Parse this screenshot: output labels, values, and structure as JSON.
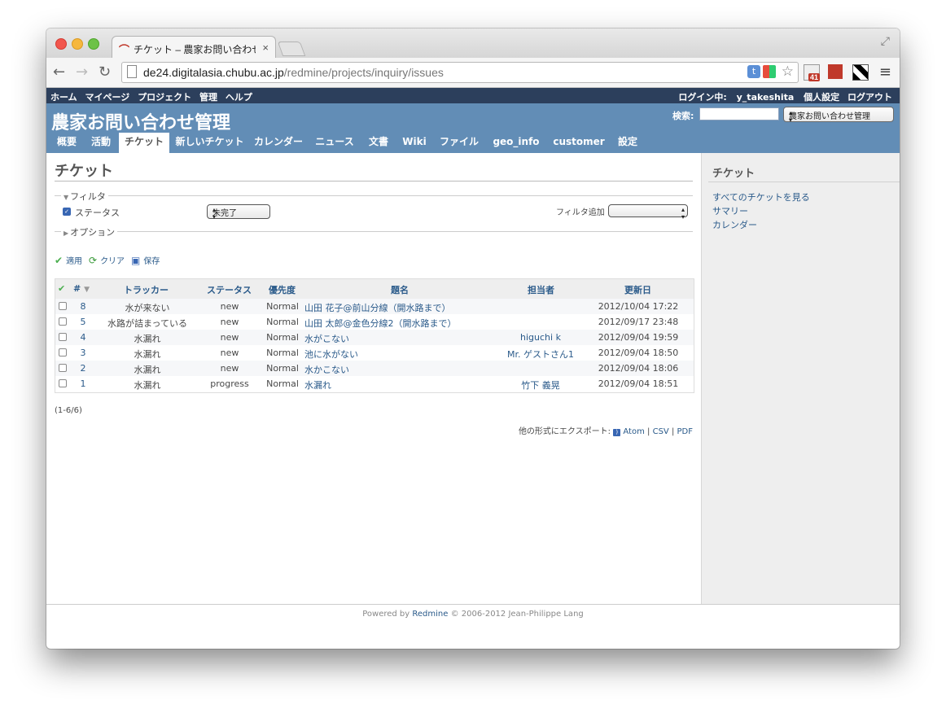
{
  "browser": {
    "tab_title": "チケット – 農家お問い合わせ管",
    "tab_close": "×",
    "url_host": "de24.digitalasia.chubu.ac.jp",
    "url_path": "/redmine/projects/inquiry/issues",
    "gmail_badge": "41",
    "ext_t_label": "t"
  },
  "topmenu": {
    "left": [
      "ホーム",
      "マイページ",
      "プロジェクト",
      "管理",
      "ヘルプ"
    ],
    "logged_in_label": "ログイン中:",
    "user": "y_takeshita",
    "my_account": "個人設定",
    "logout": "ログアウト"
  },
  "header": {
    "project_title": "農家お問い合わせ管理",
    "search_label": "検索:",
    "project_select": "農家お問い合わせ管理"
  },
  "main_menu": [
    "概要",
    "活動",
    "チケット",
    "新しいチケット",
    "カレンダー",
    "ニュース",
    "文書",
    "Wiki",
    "ファイル",
    "geo_info",
    "customer",
    "設定"
  ],
  "main_menu_selected": "チケット",
  "content": {
    "page_title": "チケット",
    "filters_legend": "フィルタ",
    "filter_status_label": "ステータス",
    "filter_status_value": "未完了",
    "add_filter_label": "フィルタ追加",
    "options_legend": "オプション",
    "apply": "適用",
    "clear": "クリア",
    "save": "保存",
    "pagination": "(1-6/6)",
    "export_label": "他の形式にエクスポート:",
    "export_atom": "Atom",
    "export_csv": "CSV",
    "export_pdf": "PDF",
    "export_sep": "|"
  },
  "table": {
    "headers": {
      "id": "#",
      "tracker": "トラッカー",
      "status": "ステータス",
      "priority": "優先度",
      "subject": "題名",
      "assignee": "担当者",
      "updated": "更新日"
    },
    "rows": [
      {
        "id": "8",
        "tracker": "水が来ない",
        "status": "new",
        "priority": "Normal",
        "subject": "山田 花子@前山分線（開水路まで）",
        "assignee": "",
        "updated": "2012/10/04 17:22"
      },
      {
        "id": "5",
        "tracker": "水路が詰まっている",
        "status": "new",
        "priority": "Normal",
        "subject": "山田 太郎@金色分線2（開水路まで）",
        "assignee": "",
        "updated": "2012/09/17 23:48"
      },
      {
        "id": "4",
        "tracker": "水漏れ",
        "status": "new",
        "priority": "Normal",
        "subject": "水がこない",
        "assignee": "higuchi k",
        "updated": "2012/09/04 19:59"
      },
      {
        "id": "3",
        "tracker": "水漏れ",
        "status": "new",
        "priority": "Normal",
        "subject": "池に水がない",
        "assignee": "Mr. ゲストさん1",
        "updated": "2012/09/04 18:50"
      },
      {
        "id": "2",
        "tracker": "水漏れ",
        "status": "new",
        "priority": "Normal",
        "subject": "水かこない",
        "assignee": "",
        "updated": "2012/09/04 18:06"
      },
      {
        "id": "1",
        "tracker": "水漏れ",
        "status": "progress",
        "priority": "Normal",
        "subject": "水漏れ",
        "assignee": "竹下 義晃",
        "updated": "2012/09/04 18:51"
      }
    ]
  },
  "sidebar": {
    "title": "チケット",
    "links": [
      "すべてのチケットを見る",
      "サマリー",
      "カレンダー"
    ]
  },
  "footer": {
    "powered_by": "Powered by",
    "redmine": "Redmine",
    "copyright": "© 2006-2012 Jean-Philippe Lang"
  }
}
